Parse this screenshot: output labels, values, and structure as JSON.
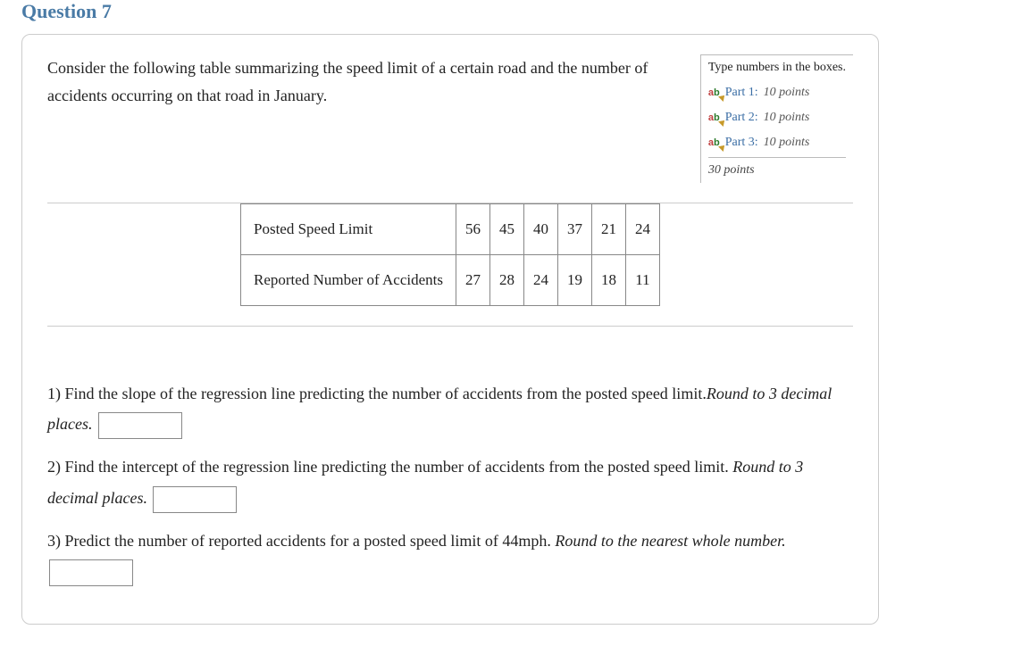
{
  "title": "Question 7",
  "intro": "Consider the following table summarizing the speed limit of a certain road and the number of accidents occurring on that road in January.",
  "points_box": {
    "header": "Type numbers in the boxes.",
    "parts": [
      {
        "label": "Part 1:",
        "points": "10 points"
      },
      {
        "label": "Part 2:",
        "points": "10 points"
      },
      {
        "label": "Part 3:",
        "points": "10 points"
      }
    ],
    "total": "30 points"
  },
  "chart_data": {
    "type": "table",
    "rows": [
      {
        "label": "Posted Speed Limit",
        "values": [
          56,
          45,
          40,
          37,
          21,
          24
        ]
      },
      {
        "label": "Reported Number of Accidents",
        "values": [
          27,
          28,
          24,
          19,
          18,
          11
        ]
      }
    ]
  },
  "questions": {
    "q1_pre": "1) Find the slope of the regression line predicting the number of accidents from the posted speed limit.",
    "q1_em": "Round to 3 decimal places.",
    "q2_pre": "2) Find the intercept of the regression line predicting the number of accidents from the posted speed limit. ",
    "q2_em": "Round to 3 decimal places.",
    "q3_pre": "3) Predict the number of reported accidents for a posted speed limit of 44mph. ",
    "q3_em": "Round to the nearest whole number."
  }
}
